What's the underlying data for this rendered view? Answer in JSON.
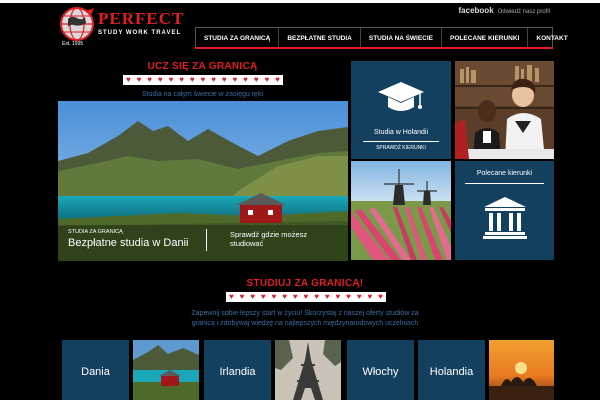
{
  "brand": {
    "name": "PERFECT",
    "tagline": "STUDY  WORK  TRAVEL",
    "est": "Est. 1995"
  },
  "facebook": {
    "brand": "facebook",
    "text": "Odwiedź nasz profil"
  },
  "nav": {
    "items": [
      "STUDIA ZA GRANICĄ",
      "BEZPŁATNE STUDIA",
      "STUDIA NA ŚWIECIE",
      "POLECANE KIERUNKI",
      "KONTAKT"
    ]
  },
  "section1": {
    "title": "UCZ SIĘ ZA GRANICĄ",
    "subtitle": "Studia na całym świecie w zasięgu ręki"
  },
  "hero": {
    "caption_small": "STUDIA ZA GRANICĄ",
    "caption_large": "Bezpłatne studia w Danii",
    "link": "Sprawdź gdzie możesz studiować"
  },
  "tiles": {
    "holland": {
      "label": "Studia w Holandii",
      "sub": "SPRAWDŹ KIERUNKI",
      "icon": "graduation-cap-icon"
    },
    "recommended": {
      "label": "Polecane kierunki",
      "icon": "university-building-icon"
    }
  },
  "section2": {
    "title": "STUDIUJ ZA GRANICĄ!",
    "desc": "Zapewnij sobie lepszy start w życiu! Skorzystaj z naszej oferty studiów za granicą i zdobywaj wiedzę na najlepszych międzynarodowych uczelniach"
  },
  "countries": [
    "Dania",
    "Irlandia",
    "Włochy",
    "Holandia"
  ],
  "colors": {
    "accent": "#e21d24",
    "tile": "#14405f",
    "subtitle": "#3a6ea5"
  }
}
